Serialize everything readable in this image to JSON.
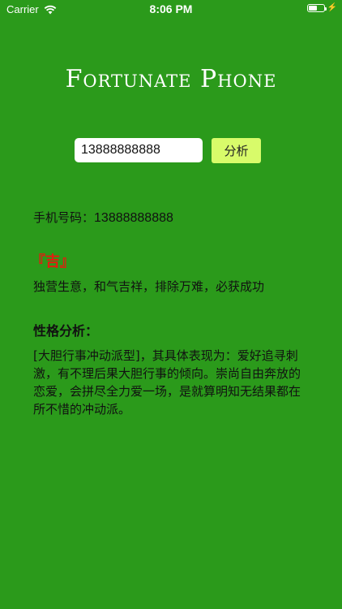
{
  "status_bar": {
    "carrier": "Carrier",
    "time": "8:06 PM"
  },
  "app": {
    "title": "Fortunate Phone"
  },
  "form": {
    "phone_value": "13888888888",
    "analyze_label": "分析"
  },
  "result": {
    "phone_label": "手机号码：",
    "phone_number": "13888888888",
    "fortune_title": "『吉』",
    "fortune_desc": "独营生意，和气吉祥，排除万难，必获成功",
    "personality_heading": "性格分析：",
    "personality_text": "[大胆行事冲动派型]，其具体表现为：爱好追寻刺激，有不理后果大胆行事的倾向。崇尚自由奔放的恋爱，会拼尽全力爱一场，是就算明知无结果都在所不惜的冲动派。"
  },
  "colors": {
    "background": "#2b9a1b",
    "button": "#d8fb6a",
    "fortune": "#e21d10"
  }
}
